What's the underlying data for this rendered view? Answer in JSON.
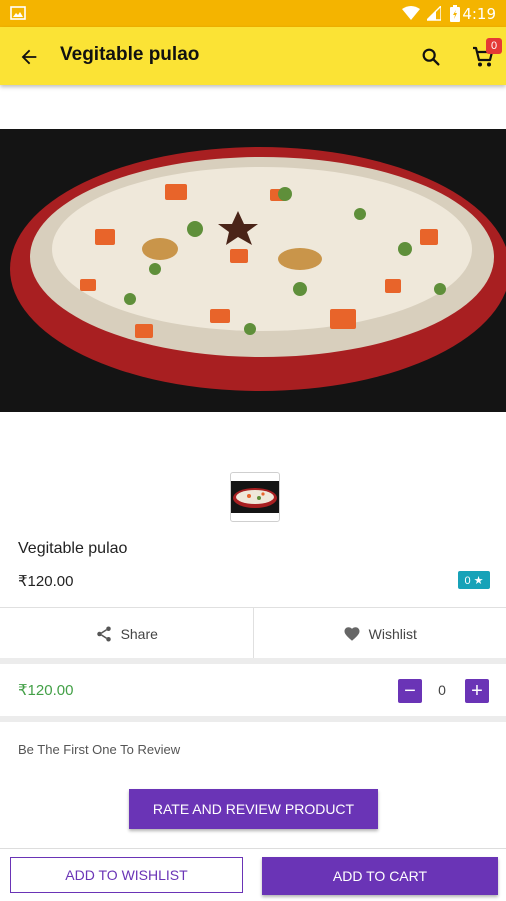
{
  "status_bar": {
    "time": "4:19"
  },
  "app_bar": {
    "title": "Vegitable pulao",
    "cart_badge": "0"
  },
  "product": {
    "name": "Vegitable pulao",
    "price": "₹120.00",
    "rating_badge": "0 ★"
  },
  "actions": {
    "share_label": "Share",
    "wishlist_label": "Wishlist"
  },
  "cart_line": {
    "price": "₹120.00",
    "quantity": "0",
    "minus": "−",
    "plus": "+"
  },
  "reviews": {
    "empty_note": "Be The First One To Review",
    "rate_button": "RATE AND REVIEW PRODUCT"
  },
  "bottom_bar": {
    "wishlist_button": "ADD TO WISHLIST",
    "cart_button": "ADD TO CART"
  },
  "colors": {
    "status_bar": "#f4b400",
    "app_bar": "#fbe335",
    "accent": "#6a34b6",
    "price_green": "#43a047",
    "rating_teal": "#17a2b8"
  }
}
